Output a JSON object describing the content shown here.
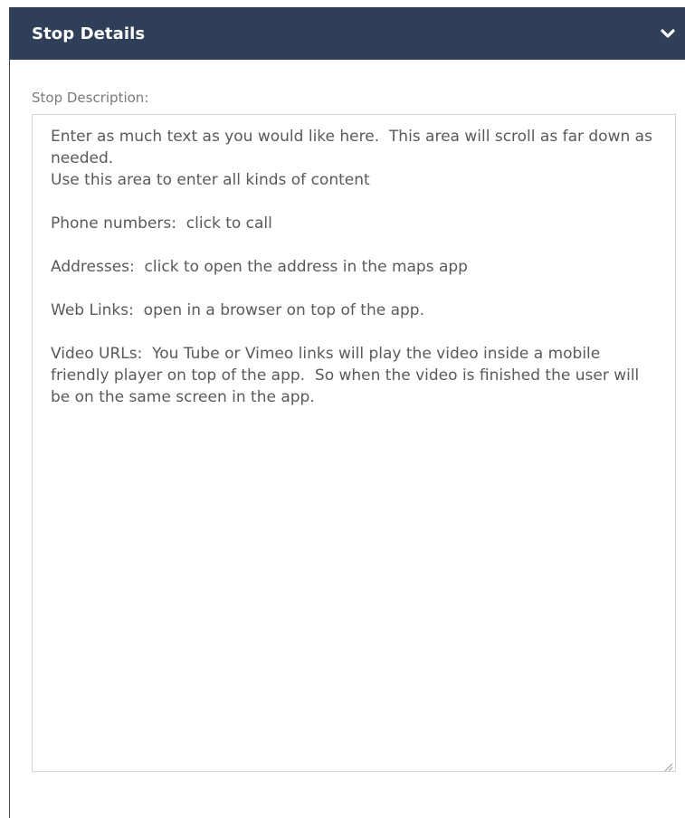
{
  "panel": {
    "title": "Stop Details",
    "toggle_icon": "chevron-down-icon",
    "header_color": "#2f3f57"
  },
  "description": {
    "label": "Stop Description:",
    "value": "Enter as much text as you would like here.  This area will scroll as far down as needed.\nUse this area to enter all kinds of content\n\nPhone numbers:  click to call\n\nAddresses:  click to open the address in the maps app\n\nWeb Links:  open in a browser on top of the app.\n\nVideo URLs:  You Tube or Vimeo links will play the video inside a mobile friendly player on top of the app.  So when the video is finished the user will be on the same screen in the app.",
    "resize_icon": "resize-grip-icon"
  }
}
